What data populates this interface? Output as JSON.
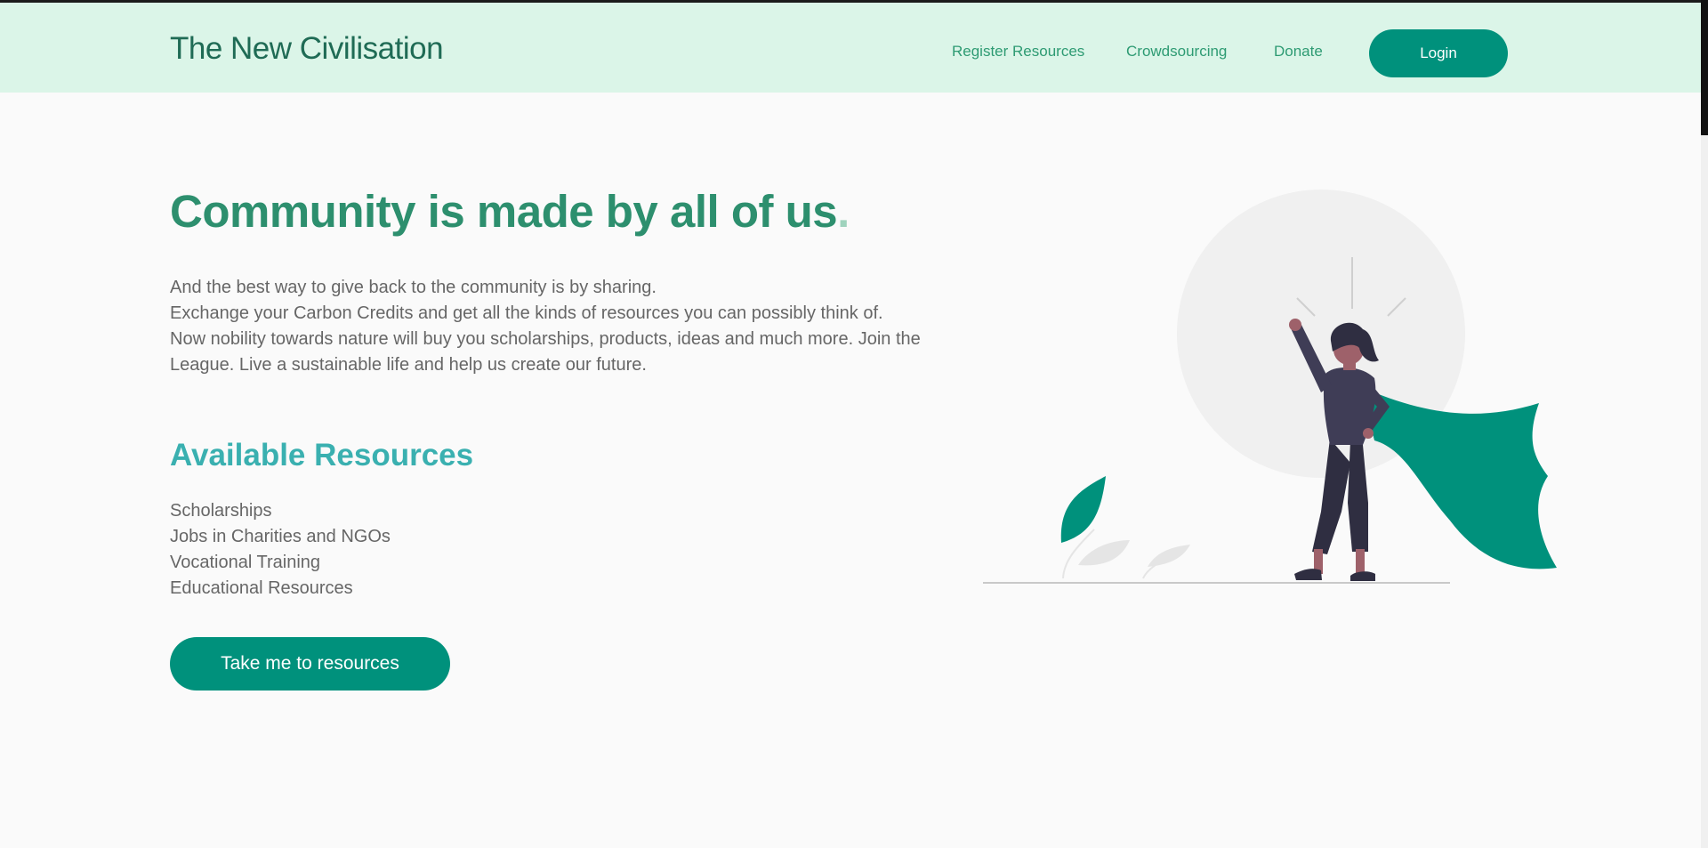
{
  "navbar": {
    "brand": "The New Civilisation",
    "links": [
      {
        "label": "Register Resources"
      },
      {
        "label": "Crowdsourcing"
      },
      {
        "label": "Donate"
      }
    ],
    "login_label": "Login"
  },
  "hero": {
    "title": "Community is made by all of us",
    "title_dot": ".",
    "paragraph_lines": [
      "And the best way to give back to the community is by sharing.",
      "Exchange your Carbon Credits and get all the kinds of resources you can possibly think of.",
      "Now nobility towards nature will buy you scholarships, products, ideas and much more. Join the League. Live a sustainable life and help us create our future."
    ]
  },
  "resources": {
    "title": "Available Resources",
    "items": [
      "Scholarships",
      "Jobs in Charities and NGOs",
      "Vocational Training",
      "Educational Resources"
    ],
    "cta_label": "Take me to resources"
  },
  "colors": {
    "nav_bg": "#dbf5e8",
    "brand": "#1f6b55",
    "accent": "#00917c",
    "title": "#2d8f6e",
    "section_title": "#3ab0b0",
    "body_text": "#666666"
  },
  "illustration": {
    "name": "superhero-woman-with-cape"
  }
}
